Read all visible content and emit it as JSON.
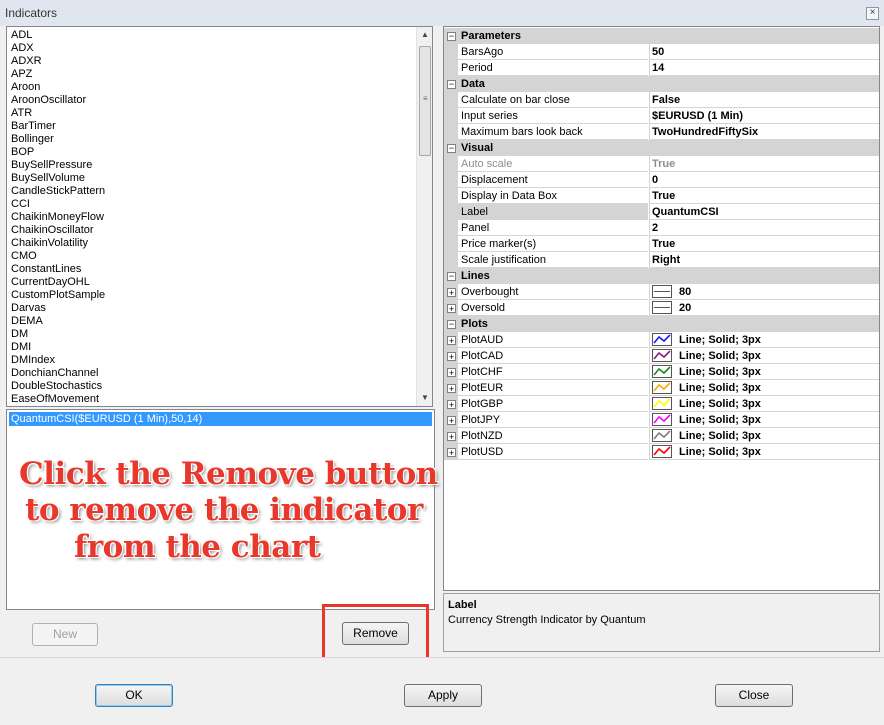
{
  "window": {
    "title": "Indicators",
    "close_glyph": "×"
  },
  "indicator_list": [
    "ADL",
    "ADX",
    "ADXR",
    "APZ",
    "Aroon",
    "AroonOscillator",
    "ATR",
    "BarTimer",
    "Bollinger",
    "BOP",
    "BuySellPressure",
    "BuySellVolume",
    "CandleStickPattern",
    "CCI",
    "ChaikinMoneyFlow",
    "ChaikinOscillator",
    "ChaikinVolatility",
    "CMO",
    "ConstantLines",
    "CurrentDayOHL",
    "CustomPlotSample",
    "Darvas",
    "DEMA",
    "DM",
    "DMI",
    "DMIndex",
    "DonchianChannel",
    "DoubleStochastics",
    "EaseOfMovement"
  ],
  "applied": {
    "selected": "QuantumCSI($EURUSD (1 Min),50,14)"
  },
  "annotation": [
    "Click the Remove button",
    "to remove the indicator",
    "from the chart"
  ],
  "buttons": {
    "new": "New",
    "remove": "Remove",
    "ok": "OK",
    "apply": "Apply",
    "close": "Close"
  },
  "properties": {
    "parameters": {
      "label": "Parameters",
      "toggle": "⊟",
      "rows": [
        {
          "name": "BarsAgo",
          "value": "50"
        },
        {
          "name": "Period",
          "value": "14"
        }
      ]
    },
    "data": {
      "label": "Data",
      "toggle": "⊟",
      "rows": [
        {
          "name": "Calculate on bar close",
          "value": "False"
        },
        {
          "name": "Input series",
          "value": "$EURUSD (1 Min)"
        },
        {
          "name": "Maximum bars look back",
          "value": "TwoHundredFiftySix"
        }
      ]
    },
    "visual": {
      "label": "Visual",
      "toggle": "⊟",
      "rows": [
        {
          "name": "Auto scale",
          "value": "True"
        },
        {
          "name": "Displacement",
          "value": "0"
        },
        {
          "name": "Display in Data Box",
          "value": "True"
        },
        {
          "name": "Label",
          "value": "QuantumCSI"
        },
        {
          "name": "Panel",
          "value": "2"
        },
        {
          "name": "Price marker(s)",
          "value": "True"
        },
        {
          "name": "Scale justification",
          "value": "Right"
        }
      ]
    },
    "lines": {
      "label": "Lines",
      "toggle": "⊟",
      "rows": [
        {
          "name": "Overbought",
          "value": "80"
        },
        {
          "name": "Oversold",
          "value": "20"
        }
      ]
    },
    "plots": {
      "label": "Plots",
      "toggle": "⊟",
      "rows": [
        {
          "name": "PlotAUD",
          "value": "Line; Solid; 3px",
          "color": "#1a1aff"
        },
        {
          "name": "PlotCAD",
          "value": "Line; Solid; 3px",
          "color": "#8b1a8b"
        },
        {
          "name": "PlotCHF",
          "value": "Line; Solid; 3px",
          "color": "#1a8b1a"
        },
        {
          "name": "PlotEUR",
          "value": "Line; Solid; 3px",
          "color": "#ffa500"
        },
        {
          "name": "PlotGBP",
          "value": "Line; Solid; 3px",
          "color": "#ffff00"
        },
        {
          "name": "PlotJPY",
          "value": "Line; Solid; 3px",
          "color": "#ff00ff"
        },
        {
          "name": "PlotNZD",
          "value": "Line; Solid; 3px",
          "color": "#808080"
        },
        {
          "name": "PlotUSD",
          "value": "Line; Solid; 3px",
          "color": "#ff0000"
        }
      ]
    },
    "expand_glyph": "⊞"
  },
  "description": {
    "title": "Label",
    "text": "Currency Strength Indicator by Quantum"
  },
  "scroll": {
    "up": "▲",
    "down": "▼",
    "grip": "≡"
  }
}
